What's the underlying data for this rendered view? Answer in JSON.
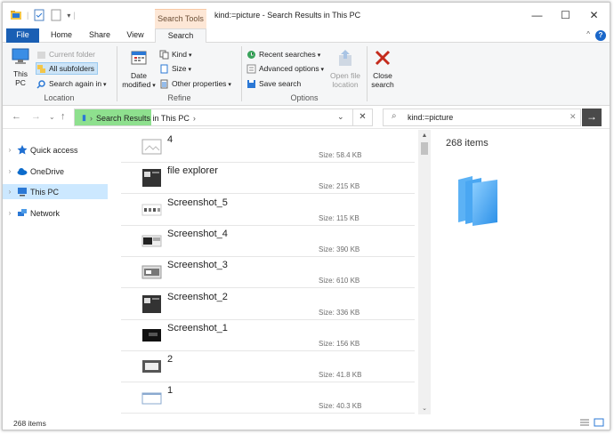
{
  "window": {
    "title": "kind:=picture - Search Results in This PC",
    "contextual_tab": "Search Tools",
    "controls": {
      "minimize": "—",
      "maximize": "☐",
      "close": "✕"
    }
  },
  "ribbon_tabs": [
    "File",
    "Home",
    "Share",
    "View",
    "Search"
  ],
  "ribbon": {
    "location": {
      "label": "Location",
      "this_pc": "This PC",
      "current_folder": "Current folder",
      "all_subfolders": "All subfolders",
      "search_again_in": "Search again in"
    },
    "refine": {
      "label": "Refine",
      "date_modified": "Date modified",
      "kind": "Kind",
      "size": "Size",
      "other_properties": "Other properties"
    },
    "options": {
      "label": "Options",
      "recent_searches": "Recent searches",
      "advanced_options": "Advanced options",
      "save_search": "Save search",
      "open_file_location": "Open file location"
    },
    "close_search": "Close search"
  },
  "address_bar": {
    "path": [
      "Search Results in This PC"
    ],
    "search_query": "kind:=picture"
  },
  "nav_pane": [
    {
      "label": "Quick access",
      "selected": false
    },
    {
      "label": "OneDrive",
      "selected": false
    },
    {
      "label": "This PC",
      "selected": true
    },
    {
      "label": "Network",
      "selected": false
    }
  ],
  "files": [
    {
      "name": "4",
      "size": "Size: 58.4 KB",
      "thumb": "blank-image"
    },
    {
      "name": "file explorer",
      "size": "Size: 215 KB",
      "thumb": "dark-screenshot"
    },
    {
      "name": "Screenshot_5",
      "size": "Size: 115 KB",
      "thumb": "light-screenshot"
    },
    {
      "name": "Screenshot_4",
      "size": "Size: 390 KB",
      "thumb": "mixed-screenshot"
    },
    {
      "name": "Screenshot_3",
      "size": "Size: 610 KB",
      "thumb": "window-screenshot"
    },
    {
      "name": "Screenshot_2",
      "size": "Size: 336 KB",
      "thumb": "dark-screenshot"
    },
    {
      "name": "Screenshot_1",
      "size": "Size: 156 KB",
      "thumb": "black-screenshot"
    },
    {
      "name": "2",
      "size": "Size: 41.8 KB",
      "thumb": "grey-screenshot"
    },
    {
      "name": "1",
      "size": "Size: 40.3 KB",
      "thumb": "blank-window"
    }
  ],
  "preview": {
    "count": "268 items"
  },
  "status": {
    "item_count": "268 items"
  },
  "colors": {
    "accent": "#1a5fb4",
    "selection": "#cce8ff",
    "address_highlight": "#8ee08e",
    "tools_tab": "#fde7d6"
  }
}
